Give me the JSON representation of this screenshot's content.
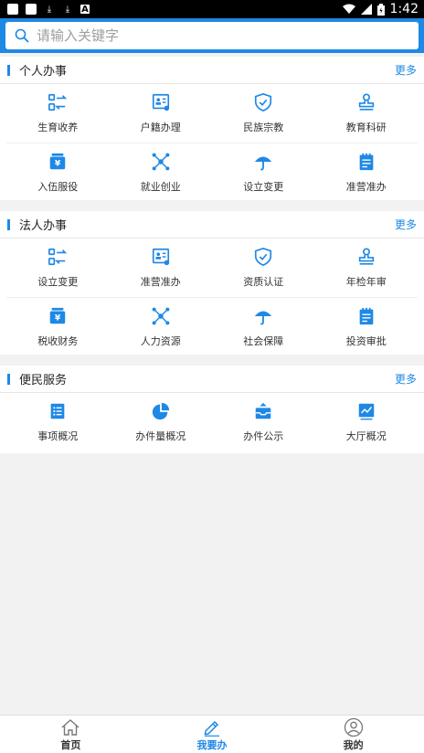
{
  "status_bar": {
    "time": "1:42"
  },
  "search": {
    "placeholder": "请输入关键字"
  },
  "sections": [
    {
      "title": "个人办事",
      "more": "更多",
      "items": [
        {
          "label": "生育收养",
          "icon": "swap-icon"
        },
        {
          "label": "户籍办理",
          "icon": "id-card-icon"
        },
        {
          "label": "民族宗教",
          "icon": "shield-icon"
        },
        {
          "label": "教育科研",
          "icon": "stamp-icon"
        },
        {
          "label": "入伍服役",
          "icon": "yen-box-icon"
        },
        {
          "label": "就业创业",
          "icon": "network-icon"
        },
        {
          "label": "设立变更",
          "icon": "umbrella-icon"
        },
        {
          "label": "准营准办",
          "icon": "notepad-icon"
        }
      ]
    },
    {
      "title": "法人办事",
      "more": "更多",
      "items": [
        {
          "label": "设立变更",
          "icon": "swap-icon"
        },
        {
          "label": "准营准办",
          "icon": "id-card-icon"
        },
        {
          "label": "资质认证",
          "icon": "shield-icon"
        },
        {
          "label": "年检年审",
          "icon": "stamp-icon"
        },
        {
          "label": "税收财务",
          "icon": "yen-box-icon"
        },
        {
          "label": "人力资源",
          "icon": "network-icon"
        },
        {
          "label": "社会保障",
          "icon": "umbrella-icon"
        },
        {
          "label": "投资审批",
          "icon": "notepad-icon"
        }
      ]
    },
    {
      "title": "便民服务",
      "more": "更多",
      "items": [
        {
          "label": "事项概况",
          "icon": "list-icon"
        },
        {
          "label": "办件量概况",
          "icon": "pie-chart-icon"
        },
        {
          "label": "办件公示",
          "icon": "inbox-icon"
        },
        {
          "label": "大厅概况",
          "icon": "line-chart-icon"
        }
      ]
    }
  ],
  "tabs": [
    {
      "label": "首页",
      "icon": "home-icon"
    },
    {
      "label": "我要办",
      "icon": "pencil-icon"
    },
    {
      "label": "我的",
      "icon": "user-icon"
    }
  ],
  "colors": {
    "accent": "#1e88e5"
  }
}
